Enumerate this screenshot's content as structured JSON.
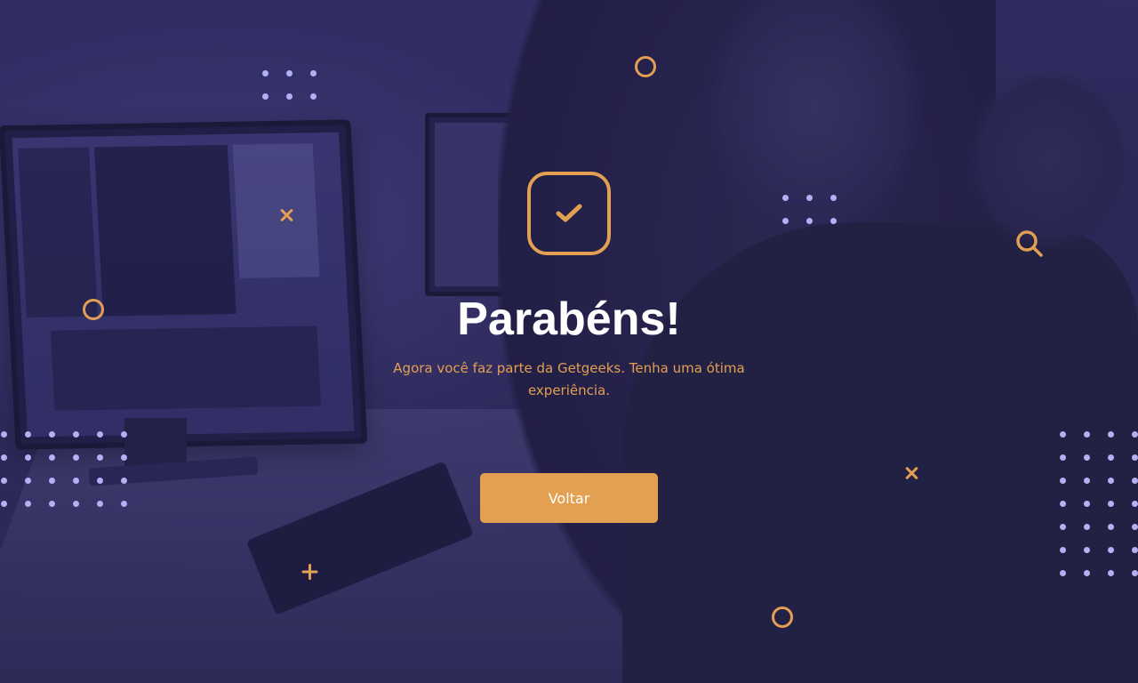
{
  "colors": {
    "accent": "#e39f52",
    "title_text": "#ffffff",
    "dots": "#b3b0f5",
    "overlay": "#2a2752"
  },
  "icons": {
    "success": "check-icon",
    "search": "search-icon"
  },
  "main": {
    "title": "Parabéns!",
    "subtitle": "Agora você faz parte da Getgeeks. Tenha uma ótima experiência.",
    "back_button_label": "Voltar"
  }
}
